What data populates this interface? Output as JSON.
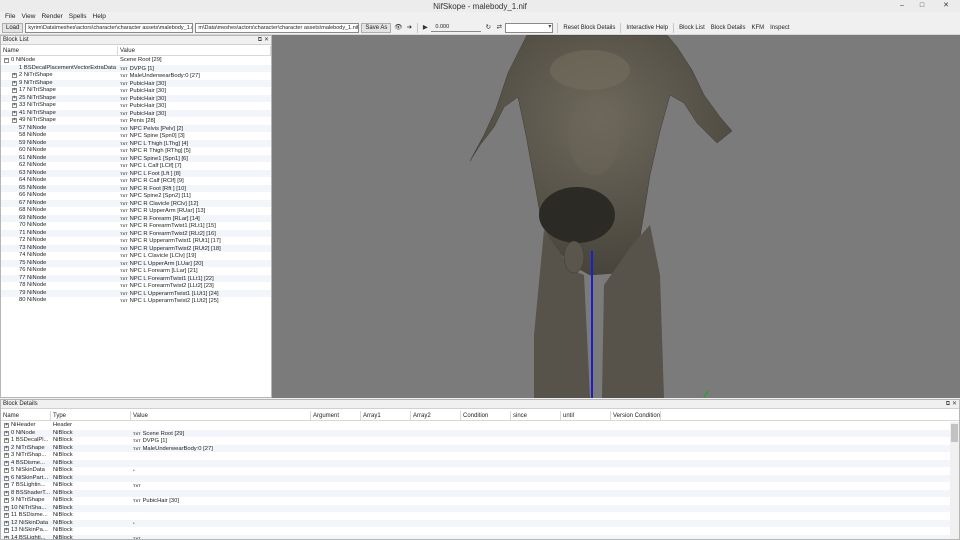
{
  "window": {
    "title": "NifSkope - malebody_1.nif",
    "minimize": "–",
    "maximize": "□",
    "close": "✕"
  },
  "menu": [
    "File",
    "View",
    "Render",
    "Spells",
    "Help"
  ],
  "toolbar": {
    "load_label": "Load",
    "load_path": "kyrim\\Data\\meshes\\actors\\character\\character assets\\malebody_1.nif",
    "save_path": "m\\Data\\meshes\\actors\\character\\character assets\\malebody_1.nif",
    "save_label": "Save As",
    "time_value": "0.000",
    "links": [
      "Reset Block Details",
      "Interactive Help",
      "Block List",
      "Block Details",
      "KFM",
      "Inspect"
    ]
  },
  "block_list": {
    "title": "Block List",
    "columns": [
      "Name",
      "Value"
    ],
    "rows": [
      {
        "name": "0 NiNode",
        "value": "Scene Root [29]",
        "expand": "−",
        "indent": 0,
        "icon": ""
      },
      {
        "name": "1 BSDecalPlacementVectorExtraData",
        "value": "DVPG [1]",
        "expand": "",
        "indent": 1,
        "icon": "TXT"
      },
      {
        "name": "2 NiTriShape",
        "value": "MaleUnderwearBody:0 [27]",
        "expand": "+",
        "indent": 1,
        "icon": "TXT"
      },
      {
        "name": "9 NiTriShape",
        "value": "PubicHair [30]",
        "expand": "+",
        "indent": 1,
        "icon": "TXT"
      },
      {
        "name": "17 NiTriShape",
        "value": "PubicHair [30]",
        "expand": "+",
        "indent": 1,
        "icon": "TXT"
      },
      {
        "name": "25 NiTriShape",
        "value": "PubicHair [30]",
        "expand": "+",
        "indent": 1,
        "icon": "TXT"
      },
      {
        "name": "33 NiTriShape",
        "value": "PubicHair [30]",
        "expand": "+",
        "indent": 1,
        "icon": "TXT"
      },
      {
        "name": "41 NiTriShape",
        "value": "PubicHair [30]",
        "expand": "+",
        "indent": 1,
        "icon": "TXT"
      },
      {
        "name": "49 NiTriShape",
        "value": "Penis [28]",
        "expand": "+",
        "indent": 1,
        "icon": "TXT"
      },
      {
        "name": "57 NiNode",
        "value": "NPC Pelvis [Pelv] [2]",
        "expand": "",
        "indent": 1,
        "icon": "TXT"
      },
      {
        "name": "58 NiNode",
        "value": "NPC Spine [Spn0] [3]",
        "expand": "",
        "indent": 1,
        "icon": "TXT"
      },
      {
        "name": "59 NiNode",
        "value": "NPC L Thigh [LThg] [4]",
        "expand": "",
        "indent": 1,
        "icon": "TXT"
      },
      {
        "name": "60 NiNode",
        "value": "NPC R Thigh [RThg] [5]",
        "expand": "",
        "indent": 1,
        "icon": "TXT"
      },
      {
        "name": "61 NiNode",
        "value": "NPC Spine1 [Spn1] [6]",
        "expand": "",
        "indent": 1,
        "icon": "TXT"
      },
      {
        "name": "62 NiNode",
        "value": "NPC L Calf [LClf] [7]",
        "expand": "",
        "indent": 1,
        "icon": "TXT"
      },
      {
        "name": "63 NiNode",
        "value": "NPC L Foot [Lft ] [8]",
        "expand": "",
        "indent": 1,
        "icon": "TXT"
      },
      {
        "name": "64 NiNode",
        "value": "NPC R Calf [RClf] [9]",
        "expand": "",
        "indent": 1,
        "icon": "TXT"
      },
      {
        "name": "65 NiNode",
        "value": "NPC R Foot [Rft ] [10]",
        "expand": "",
        "indent": 1,
        "icon": "TXT"
      },
      {
        "name": "66 NiNode",
        "value": "NPC Spine2 [Spn2] [11]",
        "expand": "",
        "indent": 1,
        "icon": "TXT"
      },
      {
        "name": "67 NiNode",
        "value": "NPC R Clavicle [RClv] [12]",
        "expand": "",
        "indent": 1,
        "icon": "TXT"
      },
      {
        "name": "68 NiNode",
        "value": "NPC R UpperArm [RUar] [13]",
        "expand": "",
        "indent": 1,
        "icon": "TXT"
      },
      {
        "name": "69 NiNode",
        "value": "NPC R Forearm [RLar] [14]",
        "expand": "",
        "indent": 1,
        "icon": "TXT"
      },
      {
        "name": "70 NiNode",
        "value": "NPC R ForearmTwist1 [RLt1] [15]",
        "expand": "",
        "indent": 1,
        "icon": "TXT"
      },
      {
        "name": "71 NiNode",
        "value": "NPC R ForearmTwist2 [RLt2] [16]",
        "expand": "",
        "indent": 1,
        "icon": "TXT"
      },
      {
        "name": "72 NiNode",
        "value": "NPC R UpperarmTwist1 [RUt1] [17]",
        "expand": "",
        "indent": 1,
        "icon": "TXT"
      },
      {
        "name": "73 NiNode",
        "value": "NPC R UpperarmTwist2 [RUt2] [18]",
        "expand": "",
        "indent": 1,
        "icon": "TXT"
      },
      {
        "name": "74 NiNode",
        "value": "NPC L Clavicle [LClv] [19]",
        "expand": "",
        "indent": 1,
        "icon": "TXT"
      },
      {
        "name": "75 NiNode",
        "value": "NPC L UpperArm [LUar] [20]",
        "expand": "",
        "indent": 1,
        "icon": "TXT"
      },
      {
        "name": "76 NiNode",
        "value": "NPC L Forearm [LLar] [21]",
        "expand": "",
        "indent": 1,
        "icon": "TXT"
      },
      {
        "name": "77 NiNode",
        "value": "NPC L ForearmTwist1 [LLt1] [22]",
        "expand": "",
        "indent": 1,
        "icon": "TXT"
      },
      {
        "name": "78 NiNode",
        "value": "NPC L ForearmTwist2 [LLt2] [23]",
        "expand": "",
        "indent": 1,
        "icon": "TXT"
      },
      {
        "name": "79 NiNode",
        "value": "NPC L UpperarmTwist1 [LUt1] [24]",
        "expand": "",
        "indent": 1,
        "icon": "TXT"
      },
      {
        "name": "80 NiNode",
        "value": "NPC L UpperarmTwist2 [LUt2] [25]",
        "expand": "",
        "indent": 1,
        "icon": "TXT"
      }
    ]
  },
  "block_details": {
    "title": "Block Details",
    "columns": [
      "Name",
      "Type",
      "Value",
      "Argument",
      "Array1",
      "Array2",
      "Condition",
      "since",
      "until",
      "Version Condition"
    ],
    "rows": [
      {
        "name": "NiHeader",
        "type": "Header",
        "value": "",
        "icon": ""
      },
      {
        "name": "0 NiNode",
        "type": "NiBlock",
        "value": "Scene Root [29]",
        "icon": "TXT"
      },
      {
        "name": "1 BSDecalPl...",
        "type": "NiBlock",
        "value": "DVPG [1]",
        "icon": "TXT"
      },
      {
        "name": "2 NiTriShape",
        "type": "NiBlock",
        "value": "MaleUnderwearBody:0 [27]",
        "icon": "TXT"
      },
      {
        "name": "3 NiTriShap...",
        "type": "NiBlock",
        "value": "",
        "icon": ""
      },
      {
        "name": "4 BSDisme...",
        "type": "NiBlock",
        "value": "",
        "icon": ""
      },
      {
        "name": "5 NiSkinData",
        "type": "NiBlock",
        "value": "",
        "icon": "*"
      },
      {
        "name": "6 NiSkinPart...",
        "type": "NiBlock",
        "value": "",
        "icon": ""
      },
      {
        "name": "7 BSLightin...",
        "type": "NiBlock",
        "value": "",
        "icon": "TXT"
      },
      {
        "name": "8 BSShaderT...",
        "type": "NiBlock",
        "value": "",
        "icon": ""
      },
      {
        "name": "9 NiTriShape",
        "type": "NiBlock",
        "value": "PubicHair [30]",
        "icon": "TXT"
      },
      {
        "name": "10 NiTriSha...",
        "type": "NiBlock",
        "value": "",
        "icon": ""
      },
      {
        "name": "11 BSDisme...",
        "type": "NiBlock",
        "value": "",
        "icon": ""
      },
      {
        "name": "12 NiSkinData",
        "type": "NiBlock",
        "value": "",
        "icon": "*"
      },
      {
        "name": "13 NiSkinPa...",
        "type": "NiBlock",
        "value": "",
        "icon": ""
      },
      {
        "name": "14 BSLighti...",
        "type": "NiBlock",
        "value": "",
        "icon": "TXT"
      }
    ]
  },
  "colors": {
    "viewport_bg": "#7b7b7b",
    "skin": "#5e5a4e",
    "axis_blue": "#1d1dcc",
    "axis_green": "#1fa81f"
  }
}
